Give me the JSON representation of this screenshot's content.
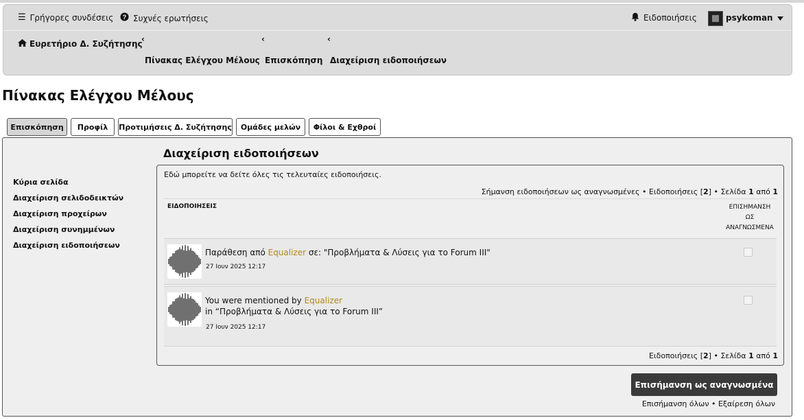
{
  "nav": {
    "quick_links": "Γρήγορες συνδέσεις",
    "faq": "Συχνές ερωτήσεις",
    "notifications": "Ειδοποιήσεις",
    "username": "psykoman"
  },
  "breadcrumbs": {
    "index": "Ευρετήριο Δ. Συζήτησης",
    "ucp": "Πίνακας Ελέγχου Μέλους",
    "overview": "Επισκόπηση",
    "manage_notifications": "Διαχείριση ειδοποιήσεων"
  },
  "page_title": "Πίνακας Ελέγχου Μέλους",
  "tabs": [
    {
      "label": "Επισκόπηση",
      "active": true
    },
    {
      "label": "Προφίλ",
      "active": false
    },
    {
      "label": "Προτιμήσεις Δ. Συζήτησης",
      "active": false
    },
    {
      "label": "Ομάδες μελών",
      "active": false
    },
    {
      "label": "Φίλοι & Εχθροί",
      "active": false
    }
  ],
  "sidebar": {
    "items": [
      {
        "label": "Κύρια σελίδα"
      },
      {
        "label": "Διαχείριση σελιδοδεικτών"
      },
      {
        "label": "Διαχείριση προχείρων"
      },
      {
        "label": "Διαχείριση συνημμένων"
      },
      {
        "label": "Διαχείριση ειδοποιήσεων"
      }
    ]
  },
  "main": {
    "title": "Διαχείριση ειδοποιήσεων",
    "intro": "Εδώ μπορείτε να δείτε όλες τις τελευταίες ειδοποιήσεις.",
    "pager_top": {
      "mark_read_link": "Σήμανση ειδοποιήσεων ως αναγνωσμένες",
      "sep": " • ",
      "count_label": "Ειδοποιήσεις [",
      "count": "2",
      "count_close": "]",
      "page_label": "Σελίδα ",
      "page": "1",
      "of_label": " από ",
      "total": "1"
    },
    "col_notifications": "ΕΙΔΟΠΟΙΗΣΕΙΣ",
    "col_mark_read": [
      "ΕΠΙΣΗΜΑΝΣΗ",
      "ΩΣ",
      "ΑΝΑΓΝΩΣΜΕΝΑ"
    ],
    "rows": [
      {
        "type_label": "Παράθεση",
        "from_label": " από ",
        "user": "Equalizer",
        "in_label": " σε: ",
        "topic": "\"Προβλήματα & Λύσεις για το Forum III\"",
        "date": "27 Ιουν 2025 12:17"
      },
      {
        "line1": "You were mentioned by ",
        "user": "Equalizer",
        "line2": "in “Προβλήματα & Λύσεις για το Forum III”",
        "date": "27 Ιουν 2025 12:17"
      }
    ],
    "pager_bottom": {
      "count_label": "Ειδοποιήσεις [",
      "count": "2",
      "count_close": "]",
      "sep": " • ",
      "page_label": "Σελίδα ",
      "page": "1",
      "of_label": " από ",
      "total": "1"
    },
    "mark_button": "Επισήμανση ως αναγνωσμένα",
    "mark_all": "Επισήμανση όλων",
    "unmark_all": "Εξαίρεση όλων",
    "links_sep": " • "
  },
  "icons": {
    "menu": "hamburger-icon",
    "faq": "question-circle-icon",
    "bell": "bell-icon",
    "home": "home-icon",
    "caret": "caret-down-icon",
    "chevron": "chevron-left-icon"
  },
  "colors": {
    "username_accent": "#b08a1a",
    "button_bg": "#3a3a3a",
    "navbar_bg": "#dcdcdc"
  }
}
